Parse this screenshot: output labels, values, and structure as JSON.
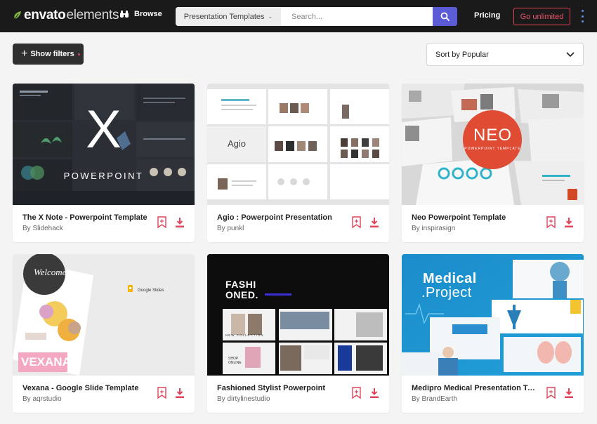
{
  "colors": {
    "header_bg": "#1a1a1a",
    "accent_green": "#82b541",
    "search_button": "#5b5bd6",
    "unlimited_red": "#e0435a",
    "icon_red": "#e0435a"
  },
  "header": {
    "logo_part1": "envato",
    "logo_part2": "elements",
    "browse_label": "Browse",
    "search_category": "Presentation Templates",
    "search_placeholder": "Search...",
    "pricing_label": "Pricing",
    "cta_label": "Go unlimited"
  },
  "toolbar": {
    "filters_label": "Show filters",
    "sort_label": "Sort by Popular"
  },
  "cards": [
    {
      "title": "The X Note - Powerpoint Template",
      "author": "By Slidehack",
      "thumb_main": "X",
      "thumb_sub": "POWERPOINT"
    },
    {
      "title": "Agio : Powerpoint Presentation",
      "author": "By punkl",
      "thumb_main": "Agio"
    },
    {
      "title": "Neo Powerpoint Template",
      "author": "By inspirasign",
      "thumb_main": "NEO",
      "thumb_sub": "POWERPOINT TEMPLATE"
    },
    {
      "title": "Vexana - Google Slide Template",
      "author": "By aqrstudio",
      "thumb_main": "VEXANA",
      "thumb_sub": "Google Slides",
      "thumb_extra": "Welcome"
    },
    {
      "title": "Fashioned Stylist Powerpoint",
      "author": "By dirtylinestudio",
      "thumb_main": "FASHI ONED.",
      "thumb_sub": "NEW COLLECTION",
      "thumb_extra": "SHOP ONLINE"
    },
    {
      "title": "Medipro Medical Presentation Te...",
      "author": "By BrandEarth",
      "thumb_main": "Medical",
      "thumb_sub": ".Project"
    }
  ]
}
